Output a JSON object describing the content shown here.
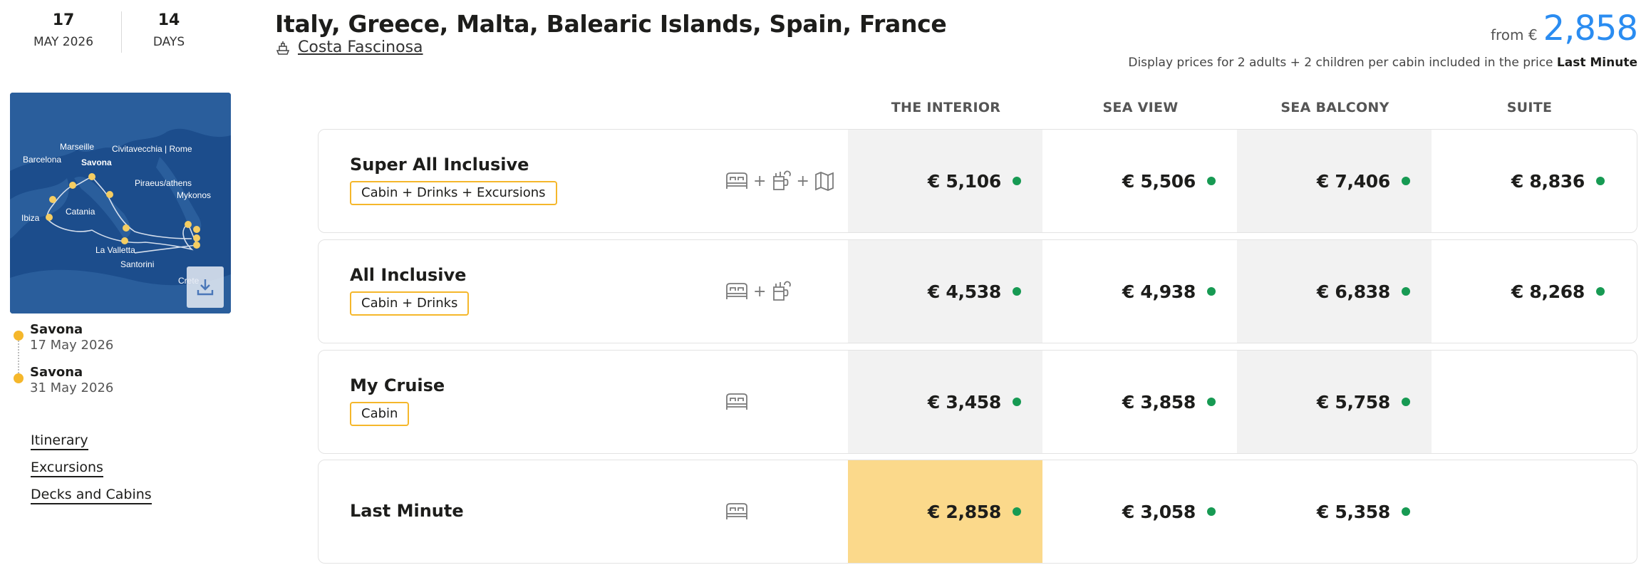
{
  "dates": {
    "day": "17",
    "month_year": "MAY 2026",
    "nights": "14",
    "nights_label": "DAYS"
  },
  "cruise": {
    "title": "Italy, Greece, Malta, Balearic Islands, Spain, France",
    "ship": "Costa Fascinosa",
    "from_label": "from €",
    "from_price": "2,858",
    "disclaimer_prefix": "Display prices for 2 adults + 2 children per cabin included in the price",
    "disclaimer_fare": "Last Minute"
  },
  "map": {
    "labels": [
      "Marseille",
      "Civitavecchia | Rome",
      "Barcelona",
      "Savona",
      "Piraeus/athens",
      "Mykonos",
      "Catania",
      "Ibiza",
      "La Valletta",
      "Santorini",
      "Crete"
    ]
  },
  "ports": [
    {
      "name": "Savona",
      "date": "17 May 2026"
    },
    {
      "name": "Savona",
      "date": "31 May 2026"
    }
  ],
  "links": [
    "Itinerary",
    "Excursions",
    "Decks and Cabins"
  ],
  "columns": [
    "THE INTERIOR",
    "SEA VIEW",
    "SEA BALCONY",
    "SUITE"
  ],
  "colors": {
    "accent": "#2a8cf1",
    "tag_border": "#f5b72b",
    "available": "#179a53",
    "highlight": "#fbd98b",
    "shade": "#f2f2f2"
  },
  "packages": [
    {
      "name": "Super All Inclusive",
      "tag": "Cabin + Drinks + Excursions",
      "icons": [
        "bed-icon",
        "drink-icon",
        "map-icon"
      ],
      "prices": [
        "€ 5,106",
        "€ 5,506",
        "€ 7,406",
        "€ 8,836"
      ]
    },
    {
      "name": "All Inclusive",
      "tag": "Cabin + Drinks",
      "icons": [
        "bed-icon",
        "drink-icon"
      ],
      "prices": [
        "€ 4,538",
        "€ 4,938",
        "€ 6,838",
        "€ 8,268"
      ]
    },
    {
      "name": "My Cruise",
      "tag": "Cabin",
      "icons": [
        "bed-icon"
      ],
      "prices": [
        "€ 3,458",
        "€ 3,858",
        "€ 5,758",
        ""
      ]
    },
    {
      "name": "Last Minute",
      "tag": "",
      "icons": [
        "bed-icon"
      ],
      "prices": [
        "€ 2,858",
        "€ 3,058",
        "€ 5,358",
        ""
      ]
    }
  ]
}
